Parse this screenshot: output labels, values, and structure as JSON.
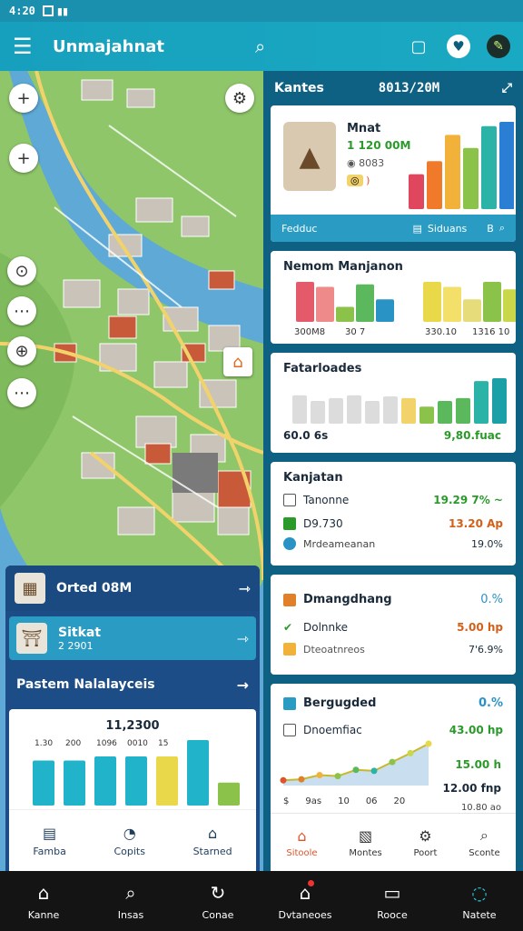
{
  "status": {
    "time": "4:20"
  },
  "appbar": {
    "title": "Unmajahnat"
  },
  "right_header": {
    "label": "Kantes",
    "date": "8013/20M"
  },
  "hero_card": {
    "name": "Mnat",
    "value": "1 120 00M",
    "sub1": "8083",
    "sub2": "",
    "footer_left": "Fedduc",
    "footer_mid": "Siduans",
    "footer_right": "B",
    "chart_data": {
      "type": "bar",
      "values": [
        40,
        55,
        85,
        70,
        95,
        100
      ]
    }
  },
  "card2": {
    "title": "Nemom Manjanon",
    "left_caption_a": "300M8",
    "left_caption_b": "30 7",
    "right_caption_a": "330.10",
    "right_caption_b": "1316 10",
    "chart_data": {
      "type": "bar",
      "series": [
        {
          "values": [
            80,
            70,
            30,
            75,
            45
          ]
        },
        {
          "values": [
            80,
            70,
            45,
            80,
            65
          ]
        }
      ]
    }
  },
  "card3": {
    "title": "Fatarloades",
    "left_value": "60.0 6s",
    "right_value": "9,80.fuac",
    "chart_data": {
      "type": "bar",
      "values": [
        50,
        40,
        45,
        50,
        40,
        48,
        45,
        30,
        40,
        45,
        75,
        80
      ]
    }
  },
  "card4": {
    "title": "Kanjatan",
    "rows": [
      {
        "label": "Tanonne",
        "value": "19.29 7% ~"
      },
      {
        "label": "D9.730",
        "value": "13.20 Ap"
      },
      {
        "label": "Mrdeameanan",
        "value": "19.0%"
      }
    ]
  },
  "card5": {
    "rows": [
      {
        "label": "Dmangdhang",
        "value": "0.%"
      },
      {
        "label": "Dolnnke",
        "value": "5.00 hp"
      },
      {
        "label": "Dteoatnreos",
        "value": "7'6.9%"
      }
    ]
  },
  "card6": {
    "rows": [
      {
        "label": "Bergugded",
        "value": "0.%"
      },
      {
        "label": "Dnoemfiac",
        "value": "43.00 hp"
      }
    ],
    "values_right": [
      "15.00 h",
      "12.00 fnp",
      "10.80 ao"
    ],
    "axis": [
      "$",
      "9as",
      "10",
      "06",
      "20"
    ],
    "chart_data": {
      "type": "line",
      "values": [
        10,
        12,
        20,
        18,
        30,
        28,
        45,
        62,
        80
      ]
    }
  },
  "bottom_tabs": [
    "Sitoole",
    "Montes",
    "Poort",
    "Sconte"
  ],
  "left_panel": {
    "row1": "Orted 08M",
    "row2_title": "Sitkat",
    "row2_sub": "2 2901",
    "head": "Pastem Nalalayceis",
    "chart_top": "11,2300",
    "chart_labels": [
      "1.30",
      "200",
      "1096",
      "0010",
      "15"
    ],
    "tabs": [
      "Famba",
      "Copits",
      "Starned"
    ],
    "chart_data": {
      "type": "bar",
      "values": [
        55,
        55,
        60,
        60,
        60,
        80,
        28
      ]
    }
  },
  "nav": [
    "Kanne",
    "Insas",
    "Conae",
    "Dvtaneoes",
    "Rooce",
    "Natete"
  ]
}
